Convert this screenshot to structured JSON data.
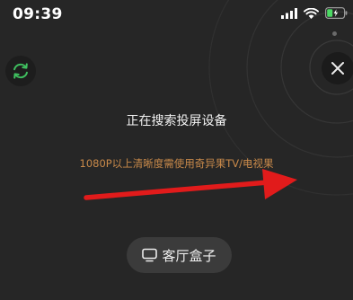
{
  "status_bar": {
    "time": "09:39",
    "signal_icon": "cellular-signal-icon",
    "wifi_icon": "wifi-icon",
    "battery_icon": "battery-charging-icon",
    "battery_color": "#4cd964"
  },
  "controls": {
    "refresh_icon": "refresh-icon",
    "refresh_color": "#3fbf5f",
    "close_icon": "close-icon"
  },
  "main": {
    "searching_text": "正在搜索投屏设备",
    "hint_text": "1080P以上清晰度需使用奇异果TV/电视果",
    "hint_color": "#c98a4a"
  },
  "annotation": {
    "arrow_icon": "red-arrow-icon",
    "arrow_color": "#e11b1b"
  },
  "device": {
    "icon": "tv-monitor-icon",
    "label": "客厅盒子"
  }
}
